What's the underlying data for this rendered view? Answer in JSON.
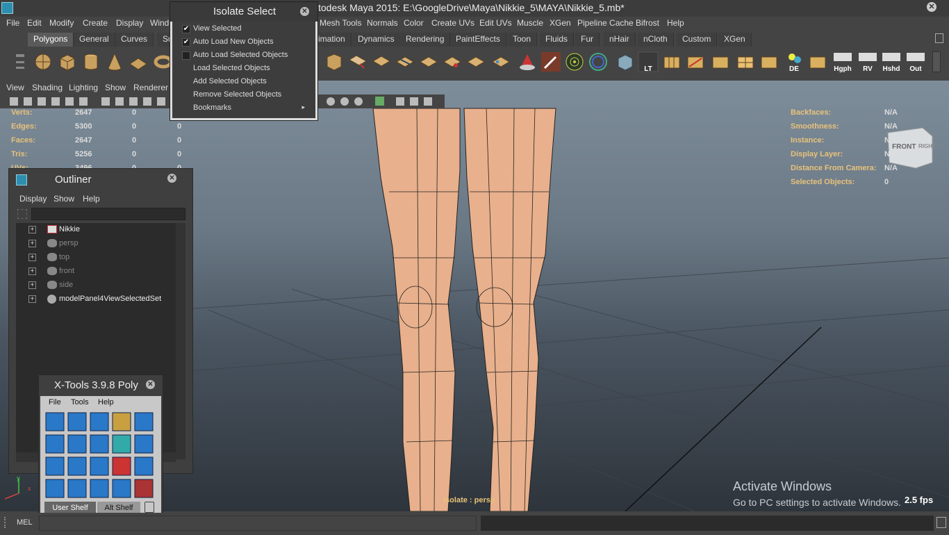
{
  "window": {
    "title": "todesk Maya 2015: E:\\GoogleDrive\\Maya\\Nikkie_5\\MAYA\\Nikkie_5.mb*"
  },
  "menubar": [
    "File",
    "Edit",
    "Modify",
    "Create",
    "Display",
    "Windo",
    "Mesh Tools",
    "Normals",
    "Color",
    "Create UVs",
    "Edit UVs",
    "Muscle",
    "XGen",
    "Pipeline Cache",
    "Bifrost",
    "Help"
  ],
  "shelf_tabs": [
    "Polygons",
    "General",
    "Curves",
    "Su",
    "imation",
    "Dynamics",
    "Rendering",
    "PaintEffects",
    "Toon",
    "Fluids",
    "Fur",
    "nHair",
    "nCloth",
    "Custom",
    "XGen"
  ],
  "shelf_labels": {
    "lt": "LT",
    "de": "DE",
    "hgph": "Hgph",
    "rv": "RV",
    "hshd": "Hshd",
    "out": "Out"
  },
  "viewport": {
    "menu": [
      "View",
      "Shading",
      "Lighting",
      "Show",
      "Renderer"
    ],
    "hud_left": [
      {
        "label": "Verts:",
        "v1": "2647",
        "v2": "0",
        "v3": "0"
      },
      {
        "label": "Edges:",
        "v1": "5300",
        "v2": "0",
        "v3": "0"
      },
      {
        "label": "Faces:",
        "v1": "2647",
        "v2": "0",
        "v3": "0"
      },
      {
        "label": "Tris:",
        "v1": "5256",
        "v2": "0",
        "v3": "0"
      },
      {
        "label": "UVs:",
        "v1": "3496",
        "v2": "0",
        "v3": "0"
      }
    ],
    "hud_right": [
      {
        "label": "Backfaces:",
        "value": "N/A"
      },
      {
        "label": "Smoothness:",
        "value": "N/A"
      },
      {
        "label": "Instance:",
        "value": "N/A"
      },
      {
        "label": "Display Layer:",
        "value": "N/A"
      },
      {
        "label": "Distance From Camera:",
        "value": "N/A"
      },
      {
        "label": "Selected Objects:",
        "value": "0"
      }
    ],
    "viewcube_front": "FRONT",
    "viewcube_right": "RIGHT",
    "isolate_label": "Isolate : persp",
    "fps": "2.5 fps",
    "axis_y": "y",
    "axis_x": "x",
    "watermark_title": "Activate Windows",
    "watermark_sub": "Go to PC settings to activate Windows."
  },
  "isolate_select": {
    "title": "Isolate Select",
    "items": [
      {
        "label": "View Selected",
        "checked": true
      },
      {
        "label": "Auto Load New Objects",
        "checked": true
      },
      {
        "label": "Auto Load Selected Objects",
        "checked": false
      },
      {
        "label": "Load Selected Objects"
      },
      {
        "label": "Add Selected Objects"
      },
      {
        "label": "Remove Selected Objects"
      },
      {
        "label": "Bookmarks",
        "submenu": true
      }
    ]
  },
  "outliner": {
    "title": "Outliner",
    "menu": [
      "Display",
      "Show",
      "Help"
    ],
    "search_value": "",
    "items": [
      "Nikkie",
      "persp",
      "top",
      "front",
      "side",
      "modelPanel4ViewSelectedSet"
    ]
  },
  "xtools": {
    "title": "X-Tools 3.9.8 Poly",
    "menu": [
      "File",
      "Tools",
      "Help"
    ],
    "tabs": [
      "User Shelf",
      "Alt Shelf"
    ]
  },
  "bottom": {
    "mel": "MEL"
  },
  "colors": {
    "accent": "#e8c27a",
    "skin": "#e8b08c",
    "panel": "#444444"
  }
}
